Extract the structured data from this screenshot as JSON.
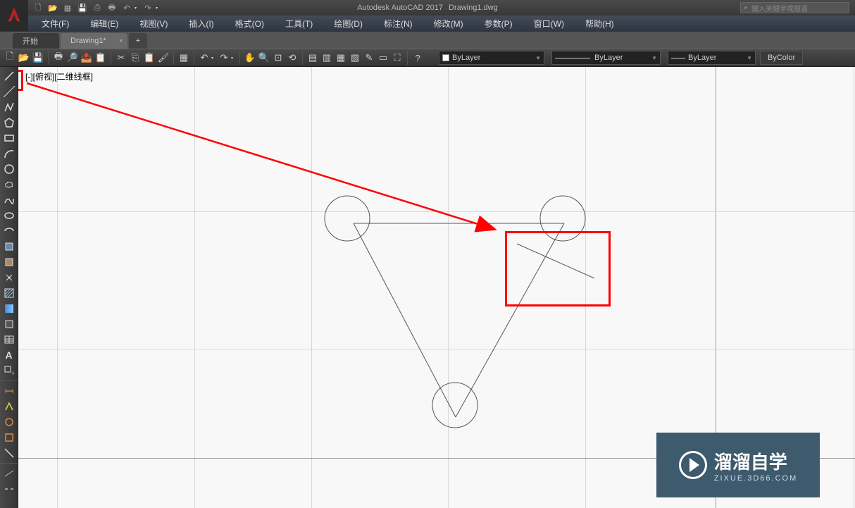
{
  "title": {
    "app": "Autodesk AutoCAD 2017",
    "file": "Drawing1.dwg"
  },
  "search": {
    "placeholder": "键入关键字或短语"
  },
  "menu": [
    "文件(F)",
    "编辑(E)",
    "视图(V)",
    "插入(I)",
    "格式(O)",
    "工具(T)",
    "绘图(D)",
    "标注(N)",
    "修改(M)",
    "参数(P)",
    "窗口(W)",
    "帮助(H)"
  ],
  "tabs": {
    "start": "开始",
    "drawing": "Drawing1*",
    "plus": "+"
  },
  "qat_icons": [
    "new-icon",
    "open-icon",
    "file-icon",
    "save-icon",
    "saveas-icon",
    "print-icon",
    "undo-icon",
    "redo-icon"
  ],
  "toolbar_icons": [
    "new-icon",
    "open-icon",
    "save-icon",
    "print-icon",
    "preview-icon",
    "publish-icon",
    "cut-icon",
    "copy-icon",
    "paste-icon",
    "match-icon",
    "block-icon",
    "undo-icon",
    "redo-icon",
    "pan-icon",
    "zoom-realtime-icon",
    "zoom-window-icon",
    "zoom-prev-icon",
    "properties-icon",
    "sheets-icon",
    "tool-palettes-icon",
    "designcenter-icon",
    "markup-icon",
    "qcalc-icon",
    "cleanscreen-icon",
    "help-icon"
  ],
  "layer": {
    "value": "ByLayer",
    "linetype": "ByLayer",
    "lineweight": "ByLayer",
    "bycolor": "ByColor"
  },
  "view": {
    "label": "[-][俯视][二维线框]"
  },
  "watermark": {
    "main": "溜溜自学",
    "sub": "ZIXUE.3D66.COM"
  }
}
